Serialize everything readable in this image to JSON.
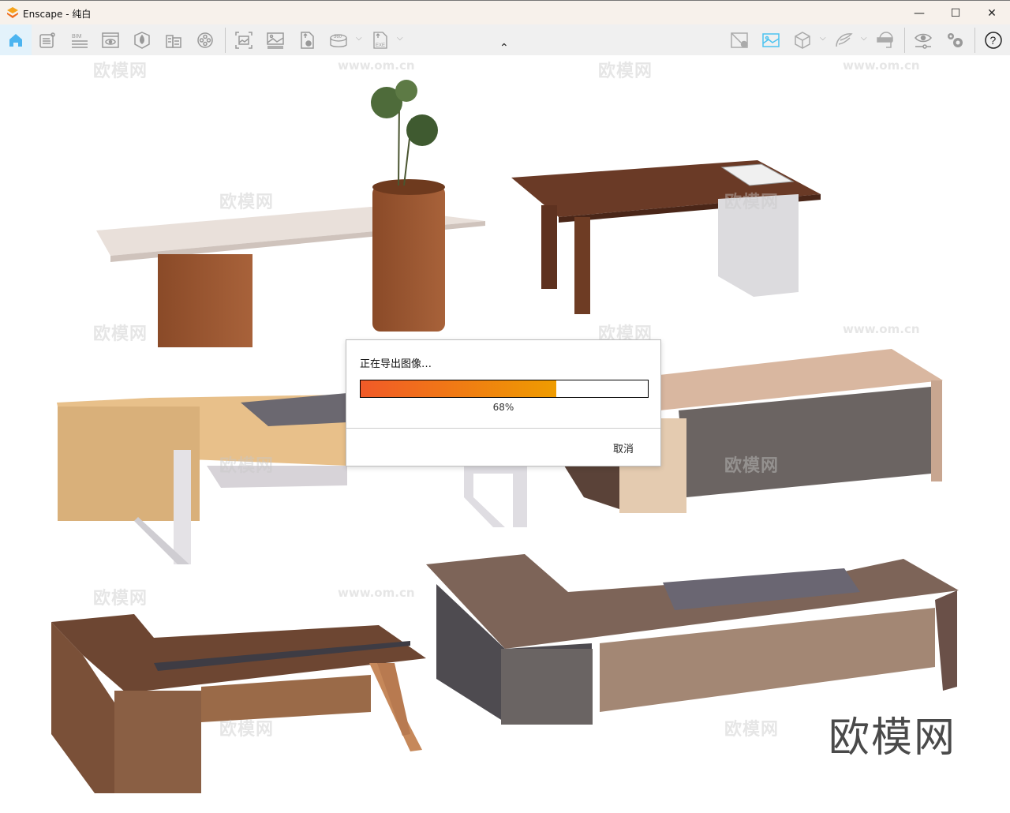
{
  "window": {
    "title": "Enscape - 纯白",
    "minimize": "—",
    "maximize": "☐",
    "close": "✕"
  },
  "toolbar": {
    "left_icons": [
      "home-icon",
      "notes-icon",
      "bim-icon",
      "view-management-icon",
      "site-context-icon",
      "asset-library-icon",
      "video-editor-icon",
      "screenshot-icon",
      "batch-render-icon",
      "panorama-export-icon",
      "panorama-360-icon",
      "exe-export-icon"
    ],
    "right_icons": [
      "map-location-icon",
      "image-settings-icon",
      "cube-view-icon",
      "wing-icon",
      "vr-headset-icon",
      "visual-settings-icon",
      "settings-icon",
      "help-icon"
    ],
    "bim_label": "BIM",
    "pano_label": "360",
    "exe_label": "EXE",
    "help_label": "?"
  },
  "dialog": {
    "message": "正在导出图像…",
    "progress_percent": 68,
    "progress_label": "68%",
    "cancel_label": "取消"
  },
  "watermarks": {
    "brand": "欧模网",
    "url": "www.om.cn"
  },
  "colors": {
    "accent": "#f28a1a",
    "active_icon": "#4cc3f0",
    "progress_start": "#f05a28",
    "progress_end": "#ef9c00"
  }
}
